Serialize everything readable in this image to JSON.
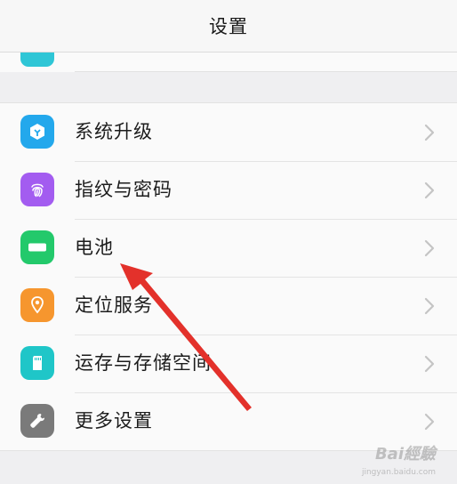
{
  "header": {
    "title": "设置"
  },
  "colors": {
    "background": "#efeff1",
    "header_bg": "#f7f7f7",
    "annotation_arrow": "#e3312b"
  },
  "list": {
    "items": [
      {
        "label": "系统升级",
        "icon": "system-update-icon",
        "icon_color": "#23a8ec"
      },
      {
        "label": "指纹与密码",
        "icon": "fingerprint-icon",
        "icon_color": "#a35cf0"
      },
      {
        "label": "电池",
        "icon": "battery-icon",
        "icon_color": "#23c96b"
      },
      {
        "label": "定位服务",
        "icon": "location-pin-icon",
        "icon_color": "#f6962e"
      },
      {
        "label": "运存与存储空间",
        "icon": "storage-card-icon",
        "icon_color": "#1fc6c8"
      },
      {
        "label": "更多设置",
        "icon": "wrench-icon",
        "icon_color": "#7a7a7a"
      }
    ]
  },
  "watermark": {
    "text": "Bai經驗",
    "sub": "jingyan.baidu.com"
  }
}
